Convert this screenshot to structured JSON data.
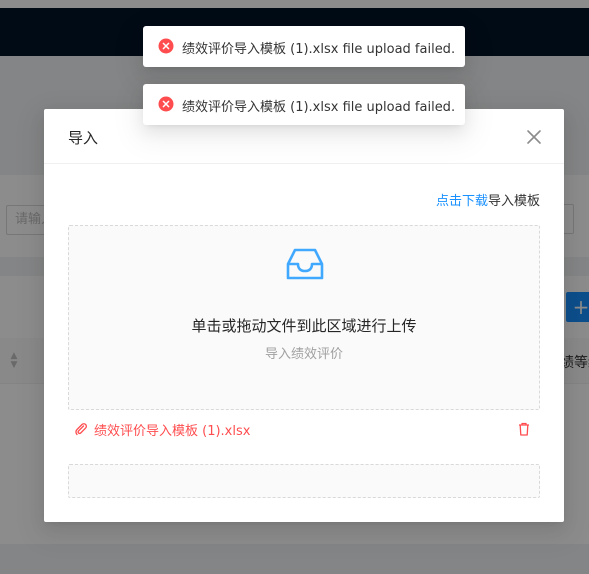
{
  "background": {
    "search_placeholder": "请输入",
    "column_label": "绩等级",
    "add_button_label": "+"
  },
  "modal": {
    "title": "导入",
    "download_link": "点击下载",
    "download_suffix": "导入模板",
    "dragger_text": "单击或拖动文件到此区域进行上传",
    "dragger_hint": "导入绩效评价",
    "file_name": "绩效评价导入模板 (1).xlsx"
  },
  "messages": [
    {
      "text": "绩效评价导入模板 (1).xlsx file upload failed."
    },
    {
      "text": "绩效评价导入模板 (1).xlsx file upload failed."
    }
  ],
  "colors": {
    "primary": "#1890ff",
    "error": "#ff4d4f",
    "header_bg": "#001529"
  },
  "icons": {
    "close": "close-icon",
    "inbox": "inbox-icon",
    "attachment": "paperclip-icon",
    "delete": "trash-icon",
    "error": "error-circle-icon"
  }
}
